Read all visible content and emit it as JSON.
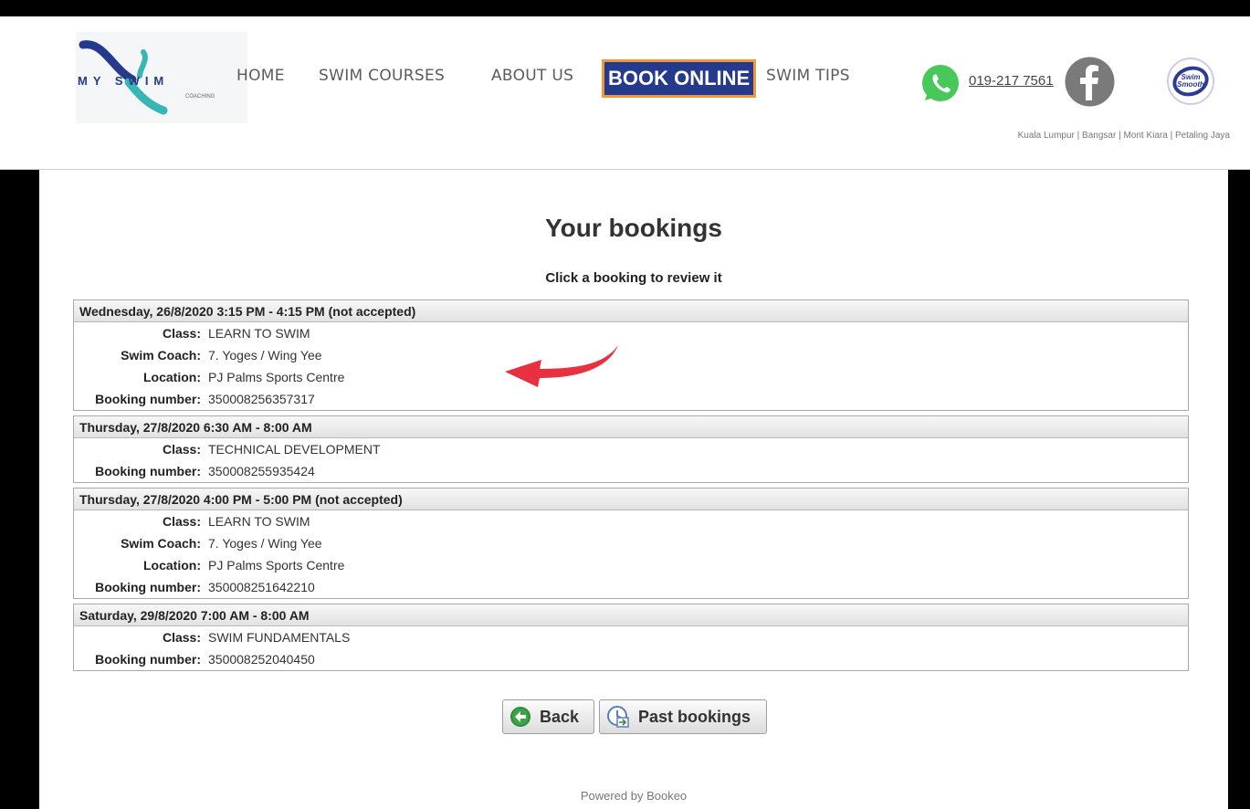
{
  "header": {
    "logo": {
      "line1": "MY SWIM",
      "line2": "COACHING"
    },
    "nav": [
      {
        "label": "HOME",
        "name": "home"
      },
      {
        "label": "SWIM COURSES",
        "name": "swim-courses"
      },
      {
        "label": "ABOUT US",
        "name": "about-us"
      },
      {
        "label": "BOOK ONLINE",
        "name": "book-online"
      },
      {
        "label": "SWIM TIPS",
        "name": "swim-tips"
      }
    ],
    "phone": "019-217 7561",
    "locations": "Kuala Lumpur | Bangsar | Mont Kiara | Petaling Jaya",
    "icons": {
      "whatsapp": "whatsapp-icon",
      "facebook": "facebook-icon",
      "swimsmooth": "swim-smooth-icon"
    },
    "colors": {
      "nav_active_bg": "#253a8c",
      "nav_active_border": "#f0973a",
      "whatsapp": "#48c75a",
      "facebook": "#7a7a7a"
    }
  },
  "main": {
    "title": "Your bookings",
    "subtitle": "Click a booking to review it",
    "bookings": [
      {
        "header": "Wednesday, 26/8/2020 3:15 PM - 4:15 PM (not accepted)",
        "rows": [
          {
            "label": "Class:",
            "value": "LEARN TO SWIM"
          },
          {
            "label": "Swim Coach:",
            "value": "7. Yoges / Wing Yee"
          },
          {
            "label": "Location:",
            "value": "PJ Palms Sports Centre"
          },
          {
            "label": "Booking number:",
            "value": "350008256357317"
          }
        ]
      },
      {
        "header": "Thursday, 27/8/2020 6:30 AM - 8:00 AM",
        "rows": [
          {
            "label": "Class:",
            "value": "TECHNICAL DEVELOPMENT"
          },
          {
            "label": "Booking number:",
            "value": "350008255935424"
          }
        ]
      },
      {
        "header": "Thursday, 27/8/2020 4:00 PM - 5:00 PM (not accepted)",
        "rows": [
          {
            "label": "Class:",
            "value": "LEARN TO SWIM"
          },
          {
            "label": "Swim Coach:",
            "value": "7. Yoges / Wing Yee"
          },
          {
            "label": "Location:",
            "value": "PJ Palms Sports Centre"
          },
          {
            "label": "Booking number:",
            "value": "350008251642210"
          }
        ]
      },
      {
        "header": "Saturday, 29/8/2020 7:00 AM - 8:00 AM",
        "rows": [
          {
            "label": "Class:",
            "value": "SWIM FUNDAMENTALS"
          },
          {
            "label": "Booking number:",
            "value": "350008252040450"
          }
        ]
      }
    ],
    "buttons": {
      "back": "Back",
      "past": "Past bookings"
    },
    "powered": "Powered by Bookeo",
    "annotation_arrow_color": "#e8303f"
  }
}
